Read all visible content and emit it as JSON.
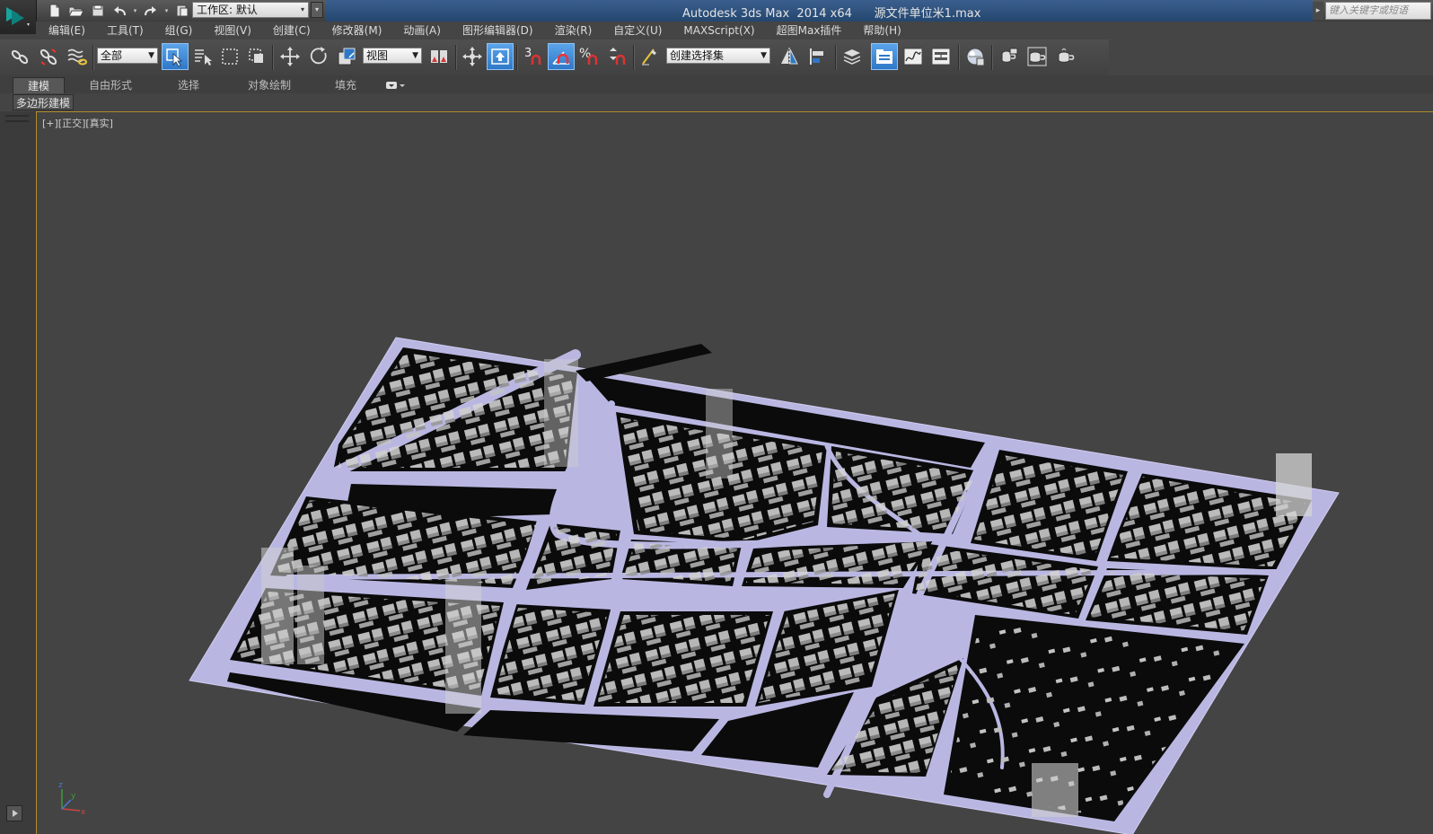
{
  "app": {
    "title": "Autodesk 3ds Max  2014 x64      源文件单位米1.max",
    "workspace": "工作区: 默认",
    "search_placeholder": "键入关键字或短语"
  },
  "menu": [
    "编辑(E)",
    "工具(T)",
    "组(G)",
    "视图(V)",
    "创建(C)",
    "修改器(M)",
    "动画(A)",
    "图形编辑器(D)",
    "渲染(R)",
    "自定义(U)",
    "MAXScript(X)",
    "超图Max插件",
    "帮助(H)"
  ],
  "toolbar": {
    "filter_value": "全部",
    "coord_value": "视图",
    "snap_label": "3",
    "percent_label": "%",
    "selection_set_value": "创建选择集",
    "active_tools": [
      "select-object",
      "use-center",
      "percent-snap",
      "scene-explorer"
    ]
  },
  "ribbon": {
    "tabs": [
      "建模",
      "自由形式",
      "选择",
      "对象绘制",
      "填充"
    ],
    "active_tab": "建模",
    "panel_label": "多边形建模"
  },
  "viewport": {
    "label": "[+][正交][真实]",
    "axis_labels": {
      "x": "x",
      "y": "y",
      "z": "z"
    }
  },
  "colors": {
    "title_band": "#2f5583",
    "accent_active": "#3d8ad8",
    "viewport_bg": "#444444",
    "ground_plane": "#b8b6e0",
    "block": "#0a0a0a",
    "building": "#bcbcbc",
    "viewport_border": "#b08a2a"
  }
}
